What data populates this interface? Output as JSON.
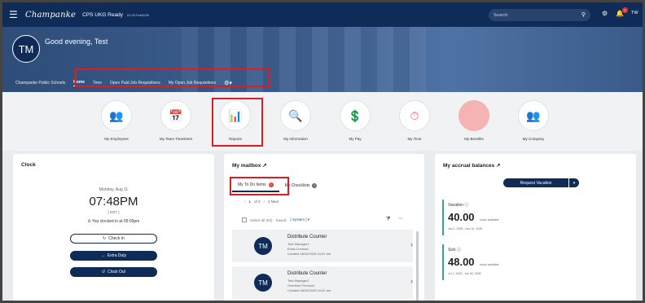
{
  "topbar": {
    "menu_icon": "☰",
    "brand": "Champanke",
    "org": "CPS UKG Ready",
    "org_sub": "01.02.Feb2025",
    "search_placeholder": "Search",
    "search_icon": "🔍",
    "help_icon": "⚙",
    "bell_icon": "🔔",
    "bell_count": "1",
    "user_initials": "TW"
  },
  "hero": {
    "avatar_initials": "TM",
    "greeting": "Good evening, Test"
  },
  "nav": {
    "items": [
      "Champanke Public Schools",
      "Home",
      "Time",
      "Open Paid Job Requisitions",
      "My Open Job Requisitions"
    ],
    "gear": "⚙▾"
  },
  "quick_links": [
    {
      "label": "My Employees",
      "icon": "👥",
      "color": "#8e44ad"
    },
    {
      "label": "My Team Timesheet",
      "icon": "📅",
      "color": "#2e8b57"
    },
    {
      "label": "Reports",
      "icon": "📊",
      "color": "#2e8b57"
    },
    {
      "label": "My Information",
      "icon": "🔍",
      "color": "#0f2b57"
    },
    {
      "label": "My Pay",
      "icon": "💲",
      "color": "#8e44ad"
    },
    {
      "label": "My Time",
      "icon": "⏱",
      "color": "#e05a6d"
    },
    {
      "label": "My Benefits",
      "icon": "●",
      "color": "#f4a6a6"
    },
    {
      "label": "My Company",
      "icon": "👥",
      "color": "#e0a020"
    }
  ],
  "clock": {
    "title": "Clock",
    "date": "Monday, Aug 11",
    "time": "07:48PM",
    "tz": "[ EDT ]",
    "status": "You clocked in at 05:00pm",
    "check_in": "Check In",
    "extra_duty": "Extra Duty",
    "clock_out": "Clock Out"
  },
  "mailbox": {
    "title": "My mailbox",
    "tab_todo": "My To Do Items",
    "tab_todo_count": "2",
    "tab_checklists": "My Checklists",
    "tab_checklists_count": "0",
    "pager_page": "1",
    "pager_of": "of 2",
    "pager_next": "2 Next",
    "select_all": "Select all (50)",
    "saved_label": "Saved:",
    "saved_value": "[ System ]",
    "messages": [
      {
        "initials": "TM",
        "title": "Distribute Counter",
        "line1": "Test Manager1",
        "line2": "Extra Contract",
        "line3": "Created 08/10/2025 04:02 am"
      },
      {
        "initials": "TM",
        "title": "Distribute Counter",
        "line1": "Test Manager1",
        "line2": "Overtime Premium",
        "line3": "Created 08/10/2025 04:02 am"
      }
    ]
  },
  "accrual": {
    "title": "My accrual balances",
    "request_btn": "Request Vacation",
    "items": [
      {
        "name": "Vacation",
        "value": "40.00",
        "unit": "hours available",
        "range": "Jan 1, 2025 - Dec 31, 2025",
        "color": "#3aa0a0"
      },
      {
        "name": "Sick",
        "value": "48.00",
        "unit": "hours available",
        "range": "Jul 1, 2025 - Jun 30, 2026",
        "color": "#3aa0a0"
      }
    ]
  }
}
